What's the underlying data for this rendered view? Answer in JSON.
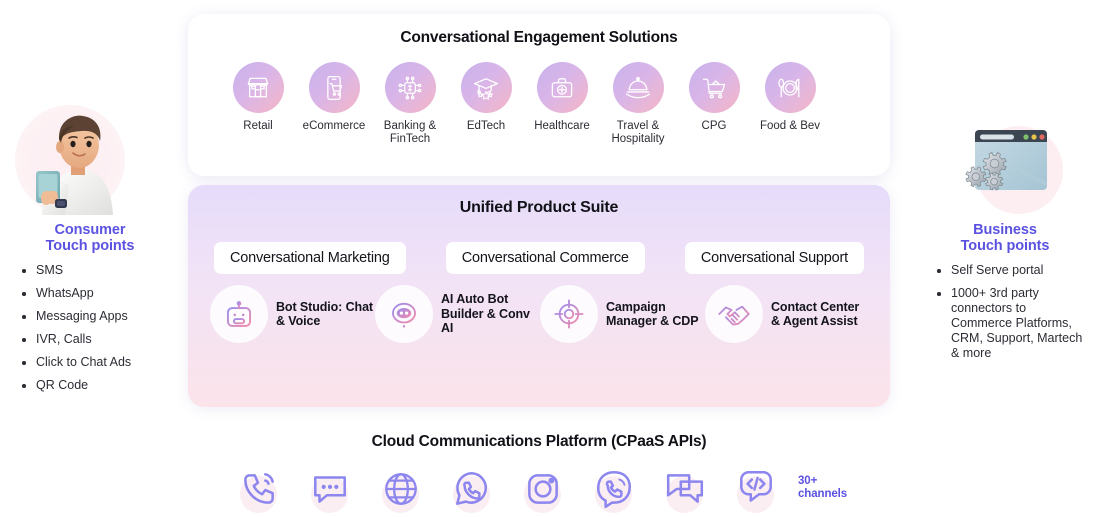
{
  "colors": {
    "accent_purple": "#5b52e0",
    "icon_purple": "#8c86ee",
    "text_dark": "#14141c",
    "gradient_top": "#e6dcfa",
    "gradient_bottom": "#fbe3e9"
  },
  "consumer": {
    "title_line1": "Consumer",
    "title_line2": "Touch points",
    "avatar_icon": "person-with-phone-illustration",
    "items": [
      "SMS",
      "WhatsApp",
      "Messaging Apps",
      "IVR, Calls",
      "Click to Chat Ads",
      "QR Code"
    ]
  },
  "business": {
    "title_line1": "Business",
    "title_line2": "Touch points",
    "avatar_icon": "browser-window-with-gears-illustration",
    "items": [
      "Self Serve portal",
      "1000+ 3rd party connectors to Commerce Platforms, CRM, Support, Martech & more"
    ]
  },
  "solutions": {
    "title": "Conversational Engagement Solutions",
    "industries": [
      {
        "label": "Retail",
        "icon": "storefront-icon"
      },
      {
        "label": "eCommerce",
        "icon": "mobile-cart-icon"
      },
      {
        "label": "Banking & FinTech",
        "icon": "fintech-chip-icon"
      },
      {
        "label": "EdTech",
        "icon": "graduation-cap-icon"
      },
      {
        "label": "Healthcare",
        "icon": "medical-kit-icon"
      },
      {
        "label": "Travel & Hospitality",
        "icon": "room-service-tray-icon"
      },
      {
        "label": "CPG",
        "icon": "shopping-cart-icon"
      },
      {
        "label": "Food & Bev",
        "icon": "cutlery-plate-icon"
      }
    ]
  },
  "suite": {
    "title": "Unified Product Suite",
    "pills": [
      "Conversational Marketing",
      "Conversational Commerce",
      "Conversational Support"
    ],
    "products": [
      {
        "label": "Bot Studio: Chat & Voice",
        "icon": "robot-icon"
      },
      {
        "label": "AI Auto Bot Builder & Conv AI",
        "icon": "ai-bot-face-icon"
      },
      {
        "label": "Campaign Manager & CDP",
        "icon": "target-crosshair-icon"
      },
      {
        "label": "Contact Center & Agent Assist",
        "icon": "handshake-icon"
      }
    ]
  },
  "cpaas": {
    "title": "Cloud Communications Platform (CPaaS APIs)",
    "channels_line1": "30+",
    "channels_line2": "channels",
    "icons": [
      "voice-call-icon",
      "sms-chat-bubble-icon",
      "globe-web-icon",
      "whatsapp-icon",
      "instagram-icon",
      "viber-icon",
      "chat-messages-icon",
      "api-code-bubble-icon"
    ]
  }
}
